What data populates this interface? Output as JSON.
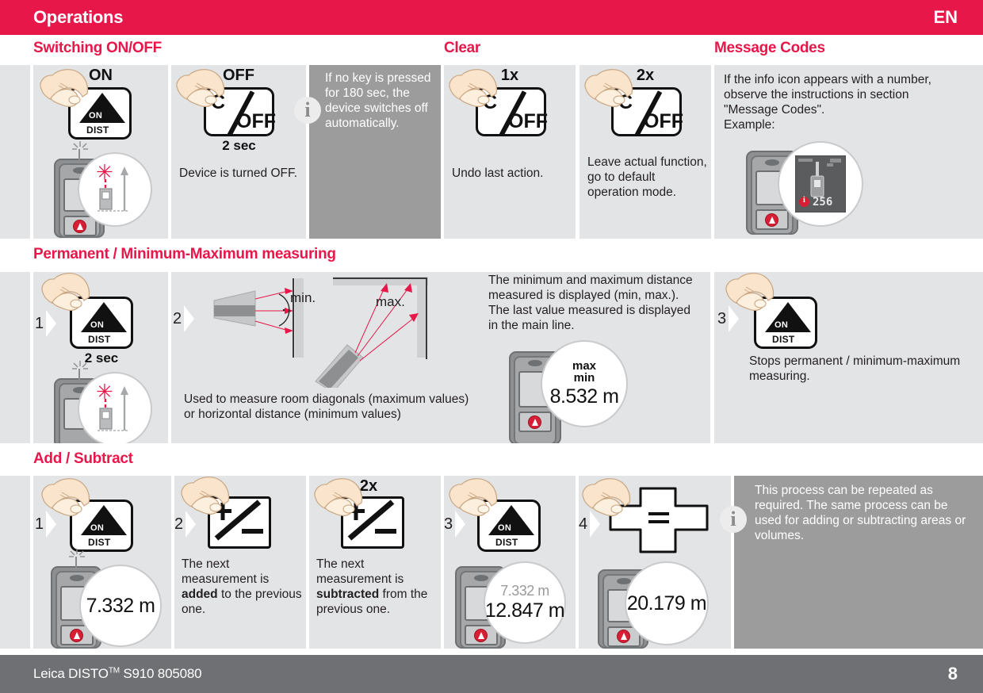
{
  "header": {
    "title": "Operations",
    "language": "EN",
    "bg_color": "#E8174A"
  },
  "sections": [
    {
      "id": "switching",
      "titles": [
        {
          "label": "Switching ON/OFF"
        },
        {
          "label": "Clear"
        },
        {
          "label": "Message Codes"
        }
      ]
    },
    {
      "id": "permanent",
      "titles": [
        {
          "label": "Permanent / Minimum-Maximum measuring"
        }
      ]
    },
    {
      "id": "addsub",
      "titles": [
        {
          "label": "Add / Subtract"
        }
      ]
    }
  ],
  "row1": {
    "on_panel": {
      "key_top_label": "ON",
      "key_triangle_label": "ON",
      "key_sub_label": "DIST",
      "icon": "hand-press-icon"
    },
    "off_panel": {
      "key_top_label": "OFF",
      "key_c": "C",
      "key_off": "OFF",
      "key_duration": "2 sec",
      "text": "Device is turned OFF."
    },
    "info_panel": {
      "icon": "info-icon",
      "text": "If no key is pressed for 180 sec, the device switches off automatically."
    },
    "clear1x_panel": {
      "key_top_label": "1x",
      "key_c": "C",
      "key_off": "OFF",
      "text": "Undo last action."
    },
    "clear2x_panel": {
      "key_top_label": "2x",
      "key_c": "C",
      "key_off": "OFF",
      "text": "Leave actual function, go to default operation mode."
    },
    "message_panel": {
      "text": "If the info icon appears with a number, observe the instructions in section \"Message Codes\".\nExample:",
      "display_code": "256"
    }
  },
  "row2": {
    "step1": {
      "number": "1",
      "key_triangle_label": "ON",
      "key_sub_label": "DIST",
      "key_duration": "2 sec"
    },
    "step2": {
      "number": "2",
      "label_min": "min.",
      "label_max": "max.",
      "text": "Used to measure room diagonals (maximum values) or horizontal distance (minimum values)"
    },
    "explain": {
      "text": "The minimum and maximum distance measured is displayed (min, max.). The last value measured is displayed in the main line.",
      "display_tag_max": "max",
      "display_tag_min": "min",
      "display_value": "8.532 m"
    },
    "step3": {
      "number": "3",
      "key_triangle_label": "ON",
      "key_sub_label": "DIST",
      "text": "Stops permanent / minimum-maximum measuring."
    }
  },
  "row3": {
    "step1": {
      "number": "1",
      "key_triangle_label": "ON",
      "key_sub_label": "DIST",
      "display_value": "7.332 m"
    },
    "step2": {
      "number": "2",
      "key_icon": "plus-minus-key-icon",
      "text_before": "The next measurement is ",
      "text_bold": "added",
      "text_after": " to the previous one."
    },
    "step2b": {
      "key_top_label": "2x",
      "key_icon": "plus-minus-key-icon",
      "text_before": "The next measurement is ",
      "text_bold": "subtracted",
      "text_after": " from the previous one."
    },
    "step3": {
      "number": "3",
      "key_triangle_label": "ON",
      "key_sub_label": "DIST",
      "display_prev": "7.332 m",
      "display_value": "12.847 m"
    },
    "step4": {
      "number": "4",
      "key_icon": "equals-navigation-key-icon",
      "key_symbol": "=",
      "display_value": "20.179 m"
    },
    "info_panel": {
      "icon": "info-icon",
      "text": "This process can be repeated as required. The same process can be used for adding or subtracting areas or volumes."
    }
  },
  "footer": {
    "product": "Leica DISTO",
    "trademark": "TM",
    "model": " S910 805080",
    "page_number": "8",
    "bg_color": "#6E7073"
  }
}
